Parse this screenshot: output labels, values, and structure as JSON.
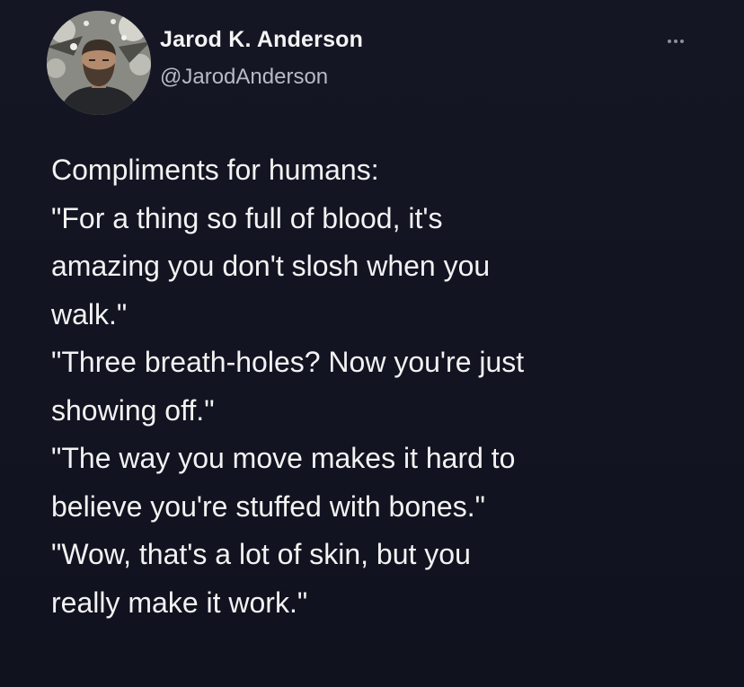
{
  "author": {
    "display_name": "Jarod K. Anderson",
    "handle": "@JarodAnderson"
  },
  "menu": {
    "icon": "more-horizontal-icon"
  },
  "tweet": {
    "intro": "Compliments for humans:",
    "lines": [
      "\"For a thing so full of blood, it's",
      "amazing you don't slosh when you",
      "walk.\"",
      "\"Three breath-holes? Now you're just",
      "showing off.\"",
      "\"The way you move makes it hard to",
      "believe you're stuffed with bones.\"",
      "\"Wow, that's a lot of skin, but you",
      "really make it work.\""
    ]
  },
  "colors": {
    "background": "#121421",
    "text": "#f2f2f2",
    "handle": "#b7bbc4"
  }
}
